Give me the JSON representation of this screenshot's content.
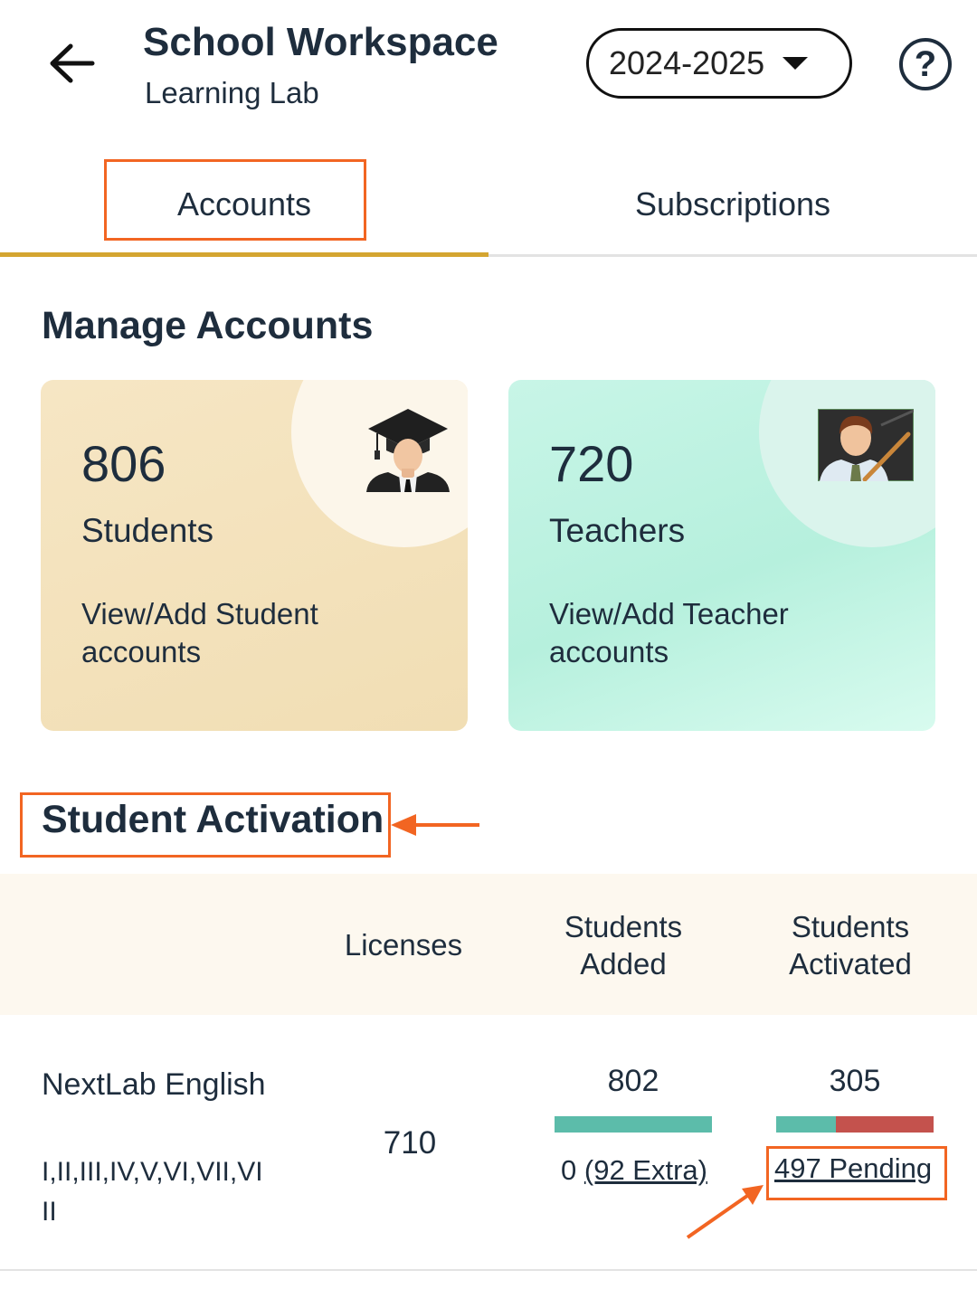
{
  "header": {
    "title": "School Workspace",
    "subtitle": "Learning Lab",
    "year": "2024-2025",
    "help_glyph": "?",
    "back_icon": "arrow-left-icon",
    "help_icon": "help-circle-icon"
  },
  "tabs": [
    {
      "label": "Accounts",
      "active": true
    },
    {
      "label": "Subscriptions",
      "active": false
    }
  ],
  "manage": {
    "title": "Manage Accounts",
    "students": {
      "count": "806",
      "label": "Students",
      "link": "View/Add Student accounts"
    },
    "teachers": {
      "count": "720",
      "label": "Teachers",
      "link": "View/Add Teacher accounts"
    }
  },
  "activation": {
    "title": "Student Activation",
    "columns": [
      "Licenses",
      "Students Added",
      "Students Activated"
    ],
    "rows": [
      {
        "product": "NextLab English",
        "grades": "I,II,III,IV,V,VI,VII,VIII",
        "licenses": "710",
        "added": "802",
        "added_remaining": "0",
        "added_extra": "(92 Extra)",
        "activated": "305",
        "activated_fraction": 0.38,
        "pending": "497 Pending"
      }
    ]
  },
  "colors": {
    "accent_tab": "#d4a531",
    "highlight": "#f26522",
    "bar_good": "#5cbcaa",
    "bar_pending": "#c4524d",
    "students_card": "#f3e1ba",
    "teachers_card": "#c2f3e3"
  }
}
